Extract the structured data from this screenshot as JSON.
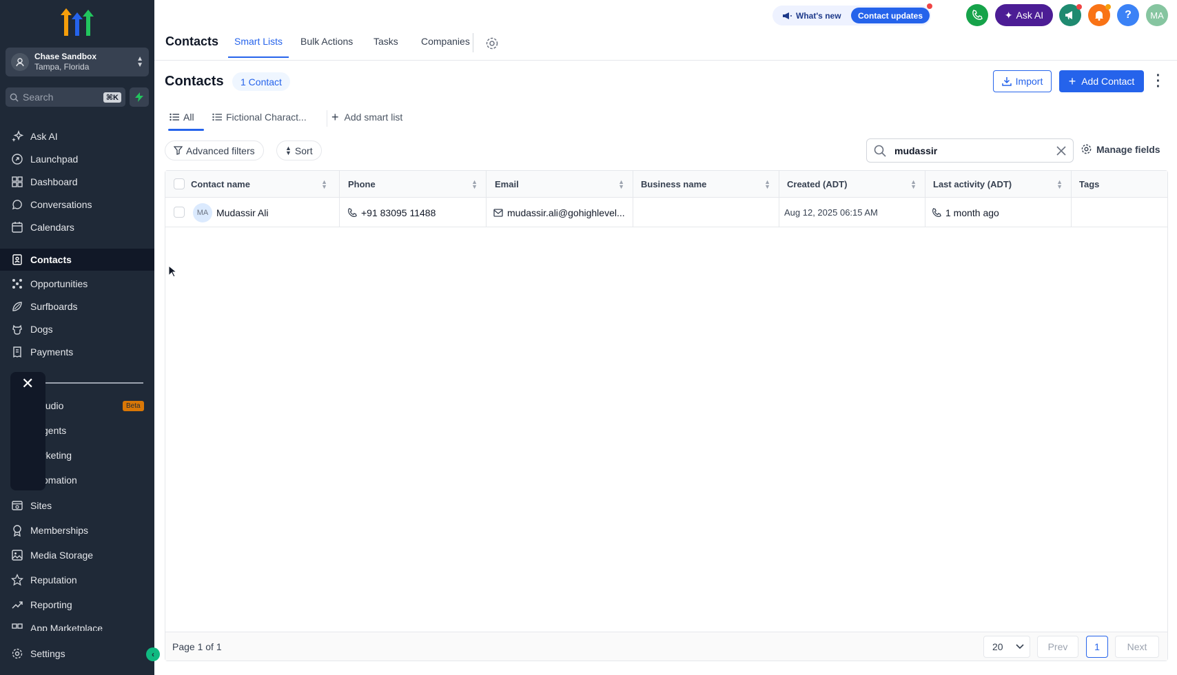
{
  "sidebar": {
    "account": {
      "name": "Chase Sandbox",
      "location": "Tampa, Florida"
    },
    "search": {
      "placeholder": "Search",
      "shortcut": "⌘K"
    },
    "items": [
      {
        "label": "Ask AI",
        "icon": "sparkle-icon"
      },
      {
        "label": "Launchpad",
        "icon": "rocket-icon"
      },
      {
        "label": "Dashboard",
        "icon": "dashboard-icon"
      },
      {
        "label": "Conversations",
        "icon": "chat-bubble-icon"
      },
      {
        "label": "Calendars",
        "icon": "calendar-icon"
      },
      {
        "label": "Contacts",
        "icon": "contact-book-icon",
        "active": true
      },
      {
        "label": "Opportunities",
        "icon": "network-icon"
      },
      {
        "label": "Surfboards",
        "icon": "surfboard-icon"
      },
      {
        "label": "Dogs",
        "icon": "dog-icon"
      },
      {
        "label": "Payments",
        "icon": "receipt-icon"
      }
    ],
    "section2": [
      {
        "label": "tudio",
        "badge": "Beta"
      },
      {
        "label": "gents"
      },
      {
        "label": "rketing"
      },
      {
        "label": "omation"
      }
    ],
    "items3": [
      {
        "label": "Sites",
        "icon": "browser-icon"
      },
      {
        "label": "Memberships",
        "icon": "award-icon"
      },
      {
        "label": "Media Storage",
        "icon": "image-icon"
      },
      {
        "label": "Reputation",
        "icon": "star-icon"
      },
      {
        "label": "Reporting",
        "icon": "trend-icon"
      },
      {
        "label": "App Marketplace",
        "icon": "apps-icon"
      }
    ],
    "settings": "Settings"
  },
  "topbar": {
    "title": "Contacts",
    "tabs": [
      "Smart Lists",
      "Bulk Actions",
      "Tasks",
      "Companies"
    ],
    "whats_new": "What's new",
    "contact_updates": "Contact updates",
    "ask_ai": "Ask AI",
    "help": "?",
    "user_initials": "MA"
  },
  "main": {
    "title": "Contacts",
    "count": "1 Contact",
    "import": "Import",
    "add_contact": "Add Contact",
    "subtabs": [
      "All",
      "Fictional Charact...",
      "Add smart list"
    ],
    "advanced_filters": "Advanced filters",
    "sort": "Sort",
    "search_value": "mudassir",
    "manage_fields": "Manage fields"
  },
  "table": {
    "columns": [
      "Contact name",
      "Phone",
      "Email",
      "Business name",
      "Created (ADT)",
      "Last activity (ADT)",
      "Tags"
    ],
    "rows": [
      {
        "initials": "MA",
        "name": "Mudassir Ali",
        "phone": "+91 83095 11488",
        "email": "mudassir.ali@gohighlevel...",
        "business": "",
        "created": "Aug 12, 2025 06:15 AM",
        "last_activity": "1 month ago",
        "tags": ""
      }
    ],
    "page_info": "Page 1 of 1",
    "page_size": "20",
    "prev": "Prev",
    "current_page": "1",
    "next": "Next"
  },
  "colors": {
    "accent": "#2563eb",
    "sidebar_bg": "#1f2937",
    "ask_ai_bg": "#4c1d95",
    "phone_green": "#16a34a",
    "bell_orange": "#f97316"
  }
}
